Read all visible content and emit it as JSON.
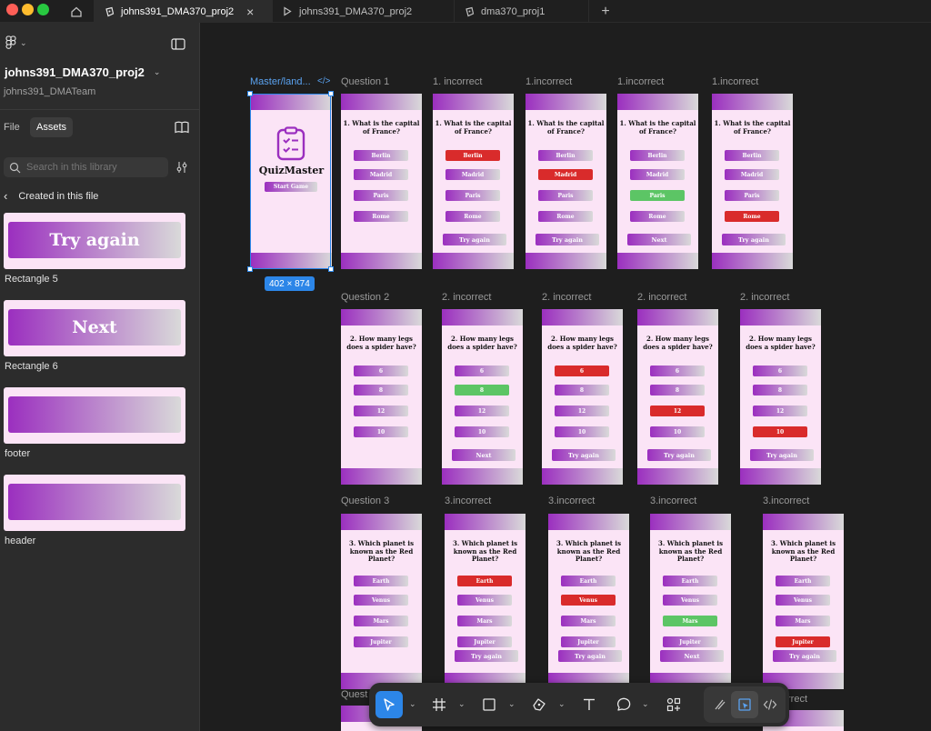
{
  "window": {
    "tabs": [
      {
        "label": "johns391_DMA370_proj2",
        "icon": "figma-file-icon"
      },
      {
        "label": "johns391_DMA370_proj2",
        "icon": "play-icon"
      },
      {
        "label": "dma370_proj1",
        "icon": "figma-file-icon"
      }
    ],
    "home_icon": "home-icon",
    "close_glyph": "×",
    "new_tab_glyph": "+"
  },
  "sidebar": {
    "file_name": "johns391_DMA370_proj2",
    "team": "johns391_DMATeam",
    "tabs": [
      "File",
      "Assets"
    ],
    "active_tab": "Assets",
    "search_placeholder": "Search in this library",
    "section": "Created in this file",
    "assets": [
      {
        "name": "Rectangle 5",
        "label": "Try again"
      },
      {
        "name": "Rectangle 6",
        "label": "Next"
      },
      {
        "name": "footer",
        "label": ""
      },
      {
        "name": "header",
        "label": ""
      }
    ]
  },
  "canvas": {
    "master": {
      "label": "Master/land...",
      "code_glyph": "</>",
      "app_title": "QuizMaster",
      "start_label": "Start Game",
      "size_badge": "402 × 874"
    },
    "rows": [
      {
        "question": "1. What is the capital of France?",
        "options": [
          "Berlin",
          "Madrid",
          "Paris",
          "Rome"
        ],
        "frames": [
          {
            "label": "Question 1",
            "states": [
              "",
              "",
              "",
              ""
            ],
            "action": ""
          },
          {
            "label": "1. incorrect",
            "states": [
              "red",
              "",
              "",
              ""
            ],
            "action": "Try again"
          },
          {
            "label": "1.incorrect",
            "states": [
              "",
              "red",
              "",
              ""
            ],
            "action": "Try again"
          },
          {
            "label": "1.incorrect",
            "states": [
              "",
              "",
              "green",
              ""
            ],
            "action": "Next"
          },
          {
            "label": "1.incorrect",
            "states": [
              "",
              "",
              "",
              "red"
            ],
            "action": "Try again"
          }
        ]
      },
      {
        "question": "2. How many legs does a spider have?",
        "options": [
          "6",
          "8",
          "12",
          "10"
        ],
        "frames": [
          {
            "label": "Question 2",
            "states": [
              "",
              "",
              "",
              ""
            ],
            "action": ""
          },
          {
            "label": "2. incorrect",
            "states": [
              "",
              "green",
              "",
              ""
            ],
            "action": "Next"
          },
          {
            "label": "2. incorrect",
            "states": [
              "red",
              "",
              "",
              ""
            ],
            "action": "Try again"
          },
          {
            "label": "2. incorrect",
            "states": [
              "",
              "",
              "red",
              ""
            ],
            "action": "Try again"
          },
          {
            "label": "2. incorrect",
            "states": [
              "",
              "",
              "",
              "red"
            ],
            "action": "Try again"
          }
        ]
      },
      {
        "question": "3. Which planet is known as the Red Planet?",
        "options": [
          "Earth",
          "Venus",
          "Mars",
          "Jupiter"
        ],
        "frames": [
          {
            "label": "Question 3",
            "states": [
              "",
              "",
              "",
              ""
            ],
            "action": ""
          },
          {
            "label": "3.incorrect",
            "states": [
              "red",
              "",
              "",
              ""
            ],
            "action": "Try again"
          },
          {
            "label": "3.incorrect",
            "states": [
              "",
              "red",
              "",
              ""
            ],
            "action": "Try again"
          },
          {
            "label": "3.incorrect",
            "states": [
              "",
              "",
              "green",
              ""
            ],
            "action": "Next"
          },
          {
            "label": "3.incorrect",
            "states": [
              "",
              "",
              "",
              "red"
            ],
            "action": "Try again"
          }
        ]
      }
    ],
    "partial_labels": [
      "Quest",
      "rrect"
    ]
  },
  "toolbar": {
    "tools": [
      "move-icon",
      "frame-icon",
      "rectangle-icon",
      "pen-icon",
      "text-icon",
      "comment-icon",
      "components-icon",
      "draw-icon",
      "dev-mode-icon",
      "code-icon"
    ]
  },
  "colors": {
    "accent": "#2c86e8",
    "frame_bg": "#fbe4f6",
    "purple": "#9b2fbf",
    "red": "#d92b2b",
    "green": "#5cc565"
  }
}
